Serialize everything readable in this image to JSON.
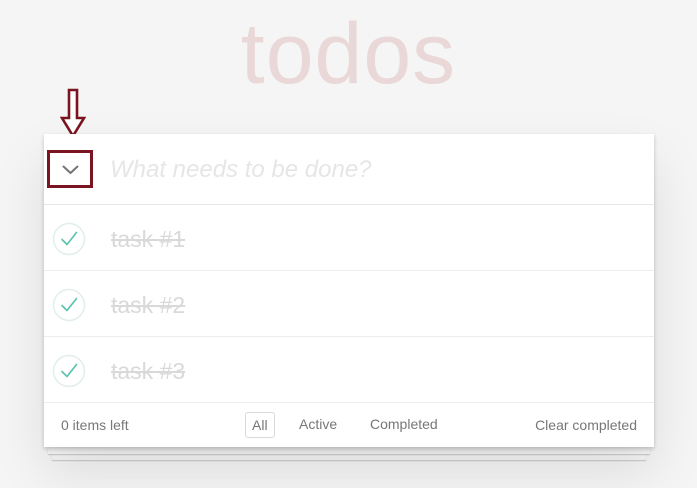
{
  "app": {
    "title": "todos"
  },
  "new_todo": {
    "placeholder": "What needs to be done?",
    "value": ""
  },
  "toggle_all": {
    "icon": "chevron-down-icon",
    "highlight_color": "#7a1420"
  },
  "annotation": {
    "icon": "down-arrow-icon",
    "color": "#7a1420"
  },
  "todos": [
    {
      "label": "task #1",
      "completed": true
    },
    {
      "label": "task #2",
      "completed": true
    },
    {
      "label": "task #3",
      "completed": true
    }
  ],
  "footer": {
    "items_left": "0 items left",
    "filters": {
      "all": "All",
      "active": "Active",
      "completed": "Completed"
    },
    "selected_filter": "All",
    "clear_completed": "Clear completed"
  },
  "colors": {
    "title": "#efd5d5",
    "check": "#5dc2af",
    "completed_text": "#d9d9d9"
  }
}
